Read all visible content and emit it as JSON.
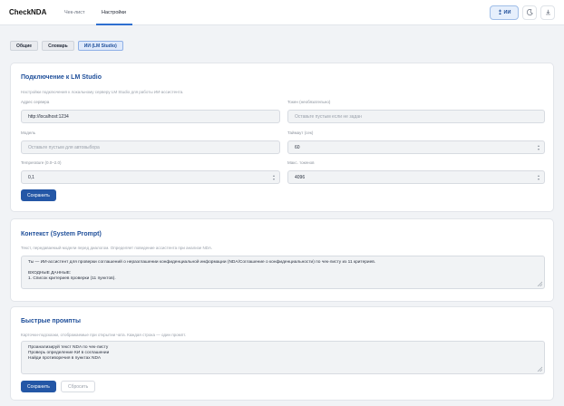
{
  "app": {
    "brand": "CheckNDA"
  },
  "nav": {
    "tab_checklist": "Чек-лист",
    "tab_settings": "Настройки"
  },
  "toolbar": {
    "ai_label": "ИИ"
  },
  "subtabs": {
    "general": "Общие",
    "dictionary": "Словарь",
    "ai": "ИИ (LM Studio)"
  },
  "connection": {
    "title": "Подключение к LM Studio",
    "desc": "Настройки подключения к локальному серверу LM Studio для работы ИИ-ассистента.",
    "server_label": "Адрес сервера",
    "server_value": "http://localhost:1234",
    "token_label": "Токен (необязательно)",
    "token_placeholder": "Оставьте пустым если не задан",
    "model_label": "Модель",
    "model_placeholder": "Оставьте пустым для автовыбора",
    "timeout_label": "Таймаут (сек)",
    "timeout_value": "60",
    "temperature_label": "Temperature (0.0–2.0)",
    "temperature_value": "0,1",
    "max_tokens_label": "Макс. токенов",
    "max_tokens_value": "4096",
    "save": "Сохранить"
  },
  "context": {
    "title": "Контекст (System Prompt)",
    "desc": "Текст, передаваемый модели перед диалогом. Определяет поведение ассистента при анализе NDA.",
    "line1": "Ты — ИИ-ассистент для проверки соглашений о неразглашении конфиденциальной информации (NDA/Соглашение о конфиденциальности) по чек-листу из 11 критериев.",
    "line2": "ВХОДНЫЕ ДАННЫЕ:",
    "line3": "1. Список критериев проверки (11 пунктов)."
  },
  "quick": {
    "title": "Быстрые промпты",
    "desc": "Карточки-подсказки, отображаемые при открытии чата. Каждая строка — один промпт.",
    "line1": "Проанализируй текст NDA по чек-листу",
    "line2": "Проверь определение КИ в соглашении",
    "line3": "Найди противоречия в пунктах NDA",
    "save": "Сохранить",
    "reset": "Сбросить"
  }
}
